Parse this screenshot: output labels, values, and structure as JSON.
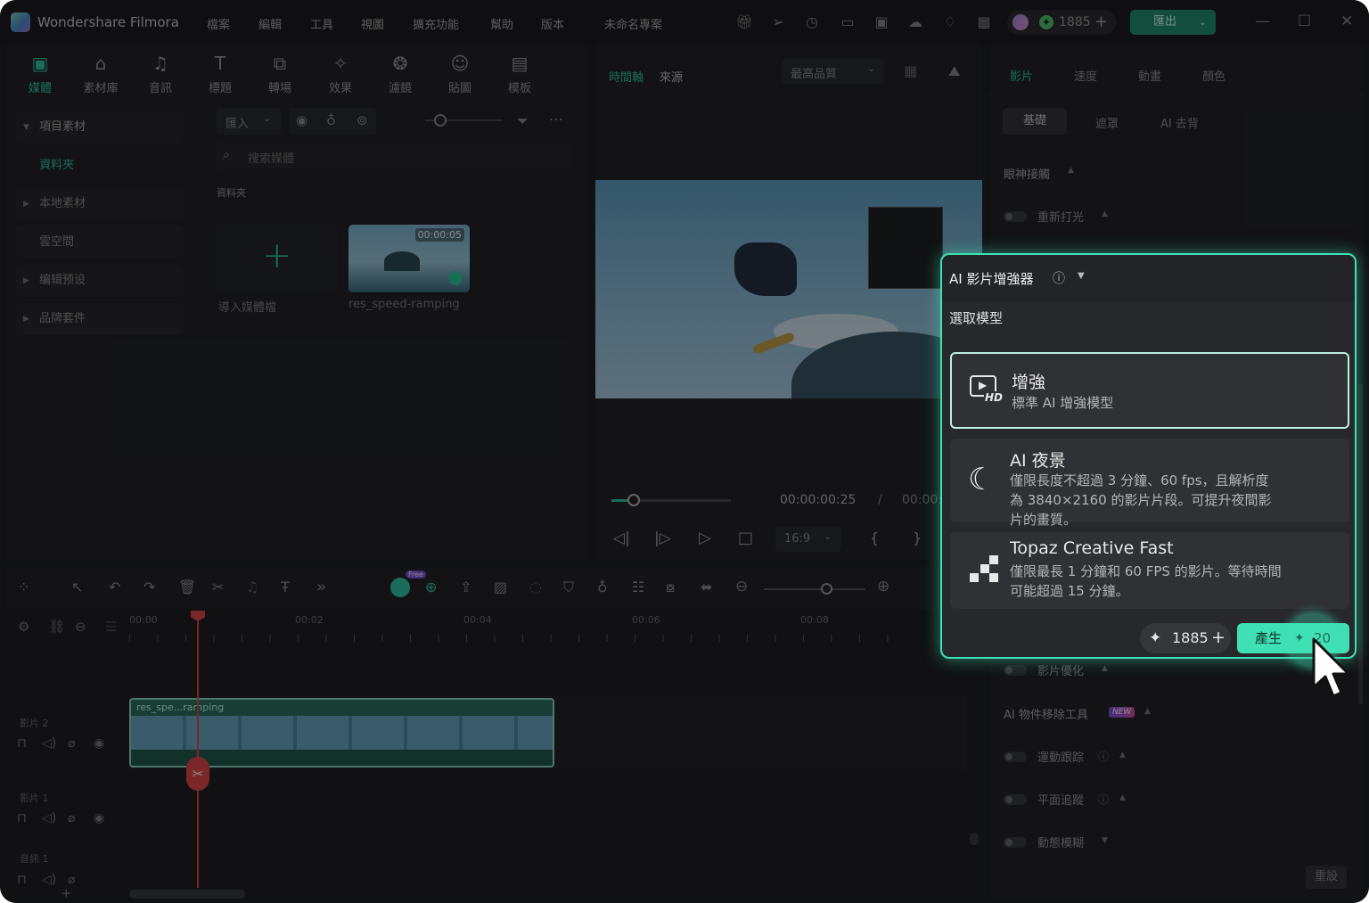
{
  "app": {
    "name": "Wondershare Filmora",
    "project": "未命名專案",
    "credits": "1885",
    "export_label": "匯出"
  },
  "menu": [
    "檔案",
    "編輯",
    "工具",
    "視圖",
    "擴充功能",
    "幫助",
    "版本"
  ],
  "toolbar": [
    {
      "label": "媒體",
      "icon": "media-icon",
      "glyph": "▣"
    },
    {
      "label": "素材庫",
      "icon": "library-icon",
      "glyph": "⌂"
    },
    {
      "label": "音訊",
      "icon": "music-icon",
      "glyph": "♫"
    },
    {
      "label": "標題",
      "icon": "title-icon",
      "glyph": "T"
    },
    {
      "label": "轉場",
      "icon": "transition-icon",
      "glyph": "⧉"
    },
    {
      "label": "效果",
      "icon": "effects-icon",
      "glyph": "✧"
    },
    {
      "label": "濾鏡",
      "icon": "filter-icon",
      "glyph": "❂"
    },
    {
      "label": "貼圖",
      "icon": "sticker-icon",
      "glyph": "☺"
    },
    {
      "label": "模板",
      "icon": "template-icon",
      "glyph": "▤"
    }
  ],
  "sidebar": {
    "items": [
      {
        "label": "項目素材",
        "expanded": true
      },
      {
        "label": "資料夾",
        "selected": true
      },
      {
        "label": "本地素材"
      },
      {
        "label": "雲空間"
      },
      {
        "label": "编辑预设"
      },
      {
        "label": "品牌套件"
      }
    ]
  },
  "media": {
    "import_label": "匯入",
    "search_placeholder": "搜索媒體",
    "folder_title": "資料夾",
    "import_media_label": "導入媒體檔",
    "clip_name": "res_speed-ramping",
    "clip_duration": "00:00:05"
  },
  "preview": {
    "tab_timeline": "時間軸",
    "tab_source": "來源",
    "quality": "最高品質",
    "current_time": "00:00:00:25",
    "separator": "/",
    "total_time": "00:00:",
    "aspect": "16:9"
  },
  "timeline": {
    "ticks": [
      "00:00",
      "00:02",
      "00:04",
      "00:06",
      "00:08"
    ],
    "clip_label": "res_spe...ramping",
    "tracks": [
      "影片 2",
      "影片 1",
      "音訊 1"
    ],
    "free_badge": "Free"
  },
  "properties": {
    "tabs": [
      "影片",
      "速度",
      "動畫",
      "顏色"
    ],
    "subtabs": [
      "基礎",
      "遮罩",
      "AI 去背"
    ],
    "eye_contact": "眼神接觸",
    "relight": "重新打光",
    "video_optimize": "影片優化",
    "ai_object_remover": "AI 物件移除工具",
    "new_badge": "NEW",
    "motion_tracking": "運動跟踪",
    "planar_tracking": "平面追蹤",
    "motion_blur": "動態模糊",
    "reset": "重設"
  },
  "popup": {
    "title": "AI 影片增強器",
    "select_model": "選取模型",
    "models": [
      {
        "title": "增強",
        "desc": "標準 AI 增強模型",
        "icon": "hd-video-icon",
        "selected": true
      },
      {
        "title": "AI 夜景",
        "desc": "僅限長度不超過 3 分鐘、60 fps，且解析度為 3840×2160 的影片片段。可提升夜間影片的畫質。",
        "icon": "night-moon-icon"
      },
      {
        "title": "Topaz Creative Fast",
        "desc": "僅限最長 1 分鐘和 60 FPS 的影片。等待時間可能超過 15 分鐘。",
        "icon": "topaz-pixel-icon"
      }
    ],
    "credits": "1885",
    "generate_label": "產生",
    "generate_cost": "20"
  },
  "colors": {
    "accent": "#3fe0b4",
    "playhead": "#e0474c",
    "clip": "#2a6f5f"
  }
}
